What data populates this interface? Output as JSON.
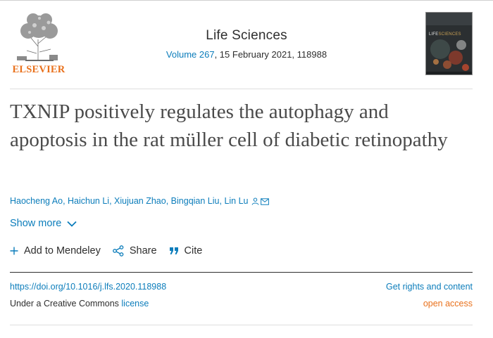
{
  "publisher": {
    "name": "ELSEVIER",
    "logo_icon": "elsevier-tree-logo",
    "brand_color": "#e9711c"
  },
  "journal": {
    "title": "Life Sciences",
    "volume_label": "Volume 267",
    "issue_date": ", 15 February 2021, 118988",
    "cover_title_a": "LIFE",
    "cover_title_b": "SCIENCES"
  },
  "article": {
    "title": "TXNIP positively regulates the autophagy and apoptosis in the rat müller cell of diabetic retinopathy",
    "authors": [
      "Haocheng Ao",
      "Haichun Li",
      "Xiujuan Zhao",
      "Bingqian Liu",
      "Lin Lu"
    ],
    "author_separator": ", ",
    "corresponding_icons": [
      "person-icon",
      "envelope-icon"
    ]
  },
  "show_more": {
    "label": "Show more",
    "icon": "chevron-down-icon"
  },
  "actions": [
    {
      "label": "Add to Mendeley",
      "icon": "plus-icon"
    },
    {
      "label": "Share",
      "icon": "share-icon"
    },
    {
      "label": "Cite",
      "icon": "quote-icon"
    }
  ],
  "footer": {
    "doi": "https://doi.org/10.1016/j.lfs.2020.118988",
    "rights_label": "Get rights and content",
    "license_prefix": "Under a Creative Commons ",
    "license_link": "license",
    "open_access": "open access"
  },
  "colors": {
    "link": "#0c7dbb",
    "text": "#2e2e2e",
    "title": "#4a4a4a",
    "accent": "#e9711c"
  }
}
